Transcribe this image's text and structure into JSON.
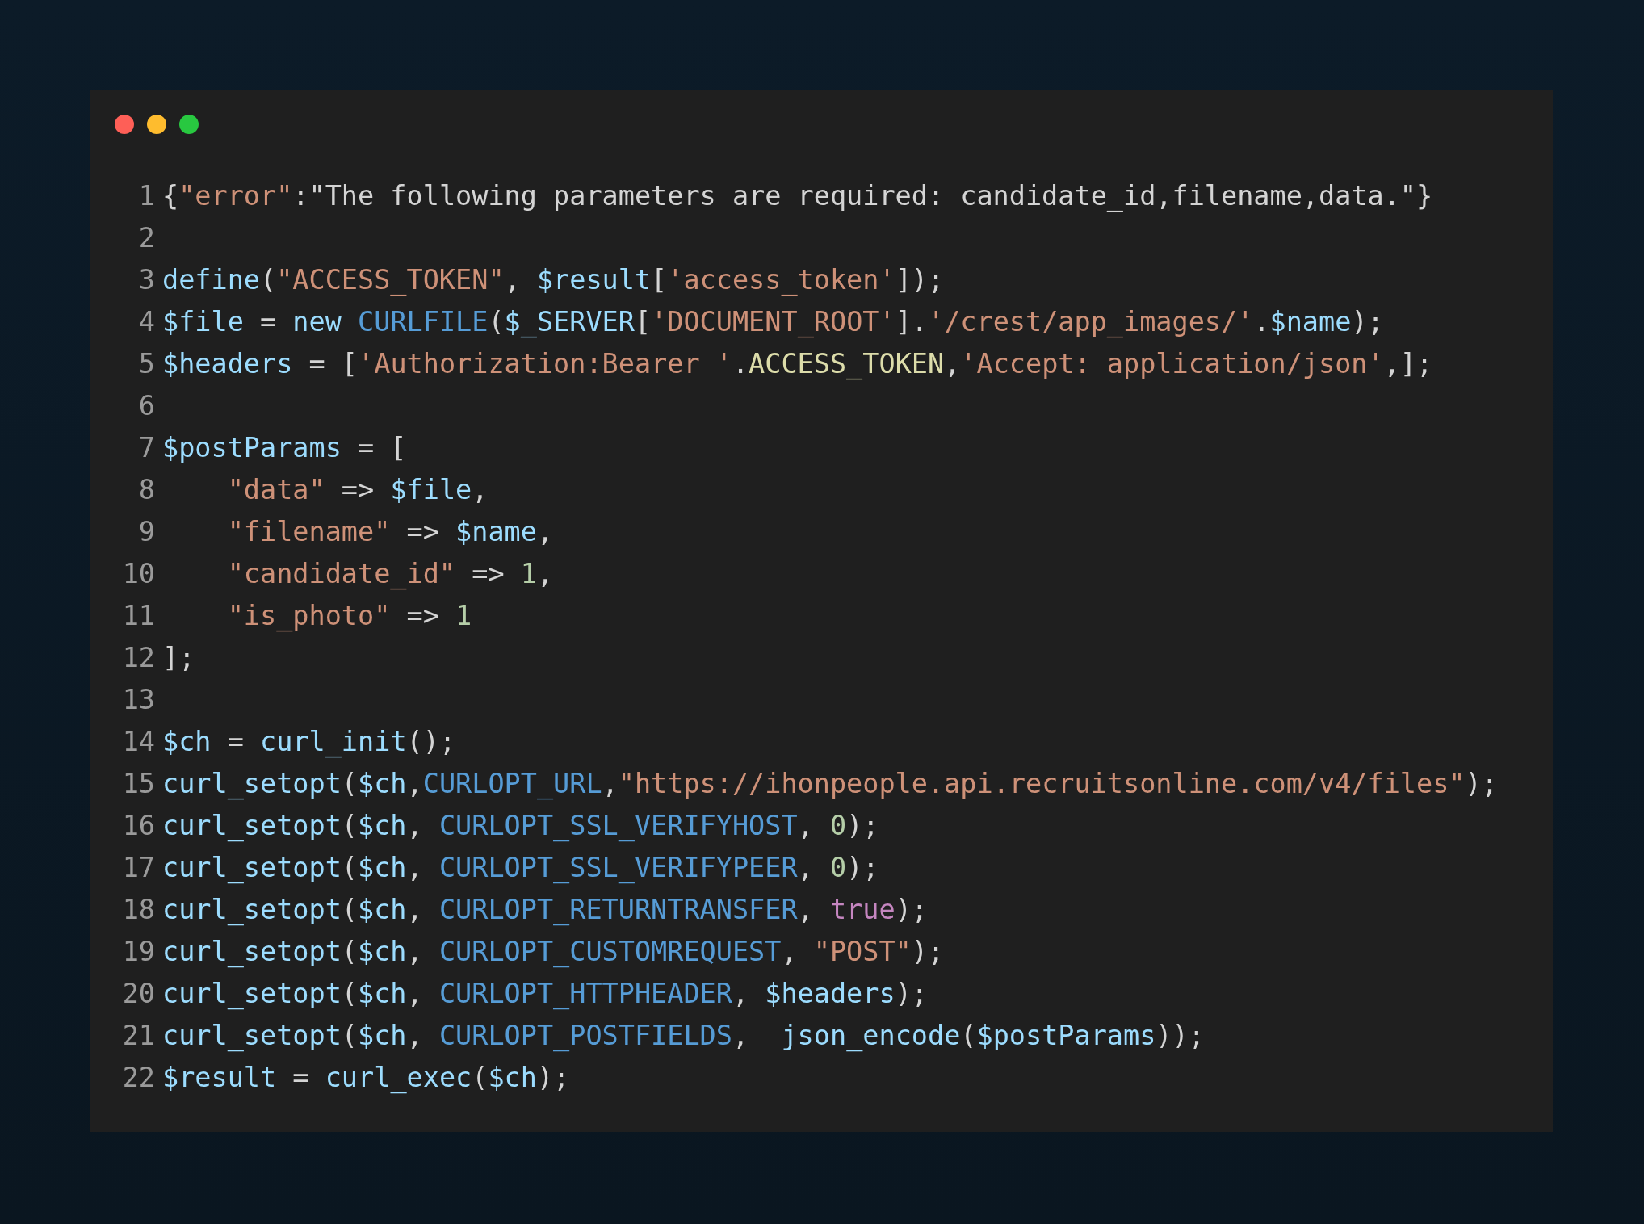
{
  "lines": [
    {
      "number": "1",
      "tokens": [
        {
          "kind": "plain",
          "text": "{"
        },
        {
          "kind": "string",
          "text": "\"error\""
        },
        {
          "kind": "plain",
          "text": ":\"The following parameters are required: candidate_id,filename,data.\"}"
        }
      ]
    },
    {
      "number": "2"
    },
    {
      "number": "3",
      "tokens": [
        {
          "kind": "func",
          "text": "define"
        },
        {
          "kind": "plain",
          "text": "("
        },
        {
          "kind": "string",
          "text": "\"ACCESS_TOKEN\""
        },
        {
          "kind": "plain",
          "text": ", "
        },
        {
          "kind": "var",
          "text": "$result"
        },
        {
          "kind": "plain",
          "text": "["
        },
        {
          "kind": "string",
          "text": "'access_token'"
        },
        {
          "kind": "plain",
          "text": "]);"
        }
      ]
    },
    {
      "number": "4",
      "tokens": [
        {
          "kind": "var",
          "text": "$file"
        },
        {
          "kind": "plain",
          "text": " = "
        },
        {
          "kind": "func",
          "text": "new "
        },
        {
          "kind": "const",
          "text": "CURLFILE"
        },
        {
          "kind": "plain",
          "text": "("
        },
        {
          "kind": "var",
          "text": "$_SERVER"
        },
        {
          "kind": "plain",
          "text": "["
        },
        {
          "kind": "string",
          "text": "'DOCUMENT_ROOT'"
        },
        {
          "kind": "plain",
          "text": "]."
        },
        {
          "kind": "string",
          "text": "'/crest/app_images/'"
        },
        {
          "kind": "plain",
          "text": "."
        },
        {
          "kind": "var",
          "text": "$name"
        },
        {
          "kind": "plain",
          "text": ");"
        }
      ]
    },
    {
      "number": "5",
      "tokens": [
        {
          "kind": "var",
          "text": "$headers"
        },
        {
          "kind": "plain",
          "text": " = ["
        },
        {
          "kind": "string",
          "text": "'Authorization:Bearer '"
        },
        {
          "kind": "plain",
          "text": "."
        },
        {
          "kind": "defined",
          "text": "ACCESS_TOKEN"
        },
        {
          "kind": "plain",
          "text": ","
        },
        {
          "kind": "string",
          "text": "'Accept: application/json'"
        },
        {
          "kind": "plain",
          "text": ",];"
        }
      ]
    },
    {
      "number": "6"
    },
    {
      "number": "7",
      "tokens": [
        {
          "kind": "var",
          "text": "$postParams"
        },
        {
          "kind": "plain",
          "text": " = ["
        }
      ],
      "children": [
        {
          "number": "8",
          "tokens": [
            {
              "kind": "string",
              "text": "\"data\""
            },
            {
              "kind": "plain",
              "text": " => "
            },
            {
              "kind": "var",
              "text": "$file"
            },
            {
              "kind": "plain",
              "text": ","
            }
          ]
        },
        {
          "number": "9",
          "tokens": [
            {
              "kind": "string",
              "text": "\"filename\""
            },
            {
              "kind": "plain",
              "text": " => "
            },
            {
              "kind": "var",
              "text": "$name"
            },
            {
              "kind": "plain",
              "text": ","
            }
          ]
        },
        {
          "number": "10",
          "tokens": [
            {
              "kind": "string",
              "text": "\"candidate_id\""
            },
            {
              "kind": "plain",
              "text": " => "
            },
            {
              "kind": "number",
              "text": "1"
            },
            {
              "kind": "plain",
              "text": ","
            }
          ]
        },
        {
          "number": "11",
          "tokens": [
            {
              "kind": "string",
              "text": "\"is_photo\""
            },
            {
              "kind": "plain",
              "text": " => "
            },
            {
              "kind": "number",
              "text": "1"
            }
          ]
        }
      ]
    },
    {
      "number": "12",
      "tokens": [
        {
          "kind": "plain",
          "text": "];"
        }
      ]
    },
    {
      "number": "13"
    },
    {
      "number": "14",
      "tokens": [
        {
          "kind": "var",
          "text": "$ch"
        },
        {
          "kind": "plain",
          "text": " = "
        },
        {
          "kind": "func",
          "text": "curl_init"
        },
        {
          "kind": "plain",
          "text": "();"
        }
      ]
    },
    {
      "number": "15",
      "tokens": [
        {
          "kind": "func",
          "text": "curl_setopt"
        },
        {
          "kind": "plain",
          "text": "("
        },
        {
          "kind": "var",
          "text": "$ch"
        },
        {
          "kind": "plain",
          "text": ","
        },
        {
          "kind": "const",
          "text": "CURLOPT_URL"
        },
        {
          "kind": "plain",
          "text": ","
        },
        {
          "kind": "string",
          "text": "\"https://ihonpeople.api.recruitsonline.com/v4/files\""
        },
        {
          "kind": "plain",
          "text": ");"
        }
      ]
    },
    {
      "number": "16",
      "tokens": [
        {
          "kind": "func",
          "text": "curl_setopt"
        },
        {
          "kind": "plain",
          "text": "("
        },
        {
          "kind": "var",
          "text": "$ch"
        },
        {
          "kind": "plain",
          "text": ", "
        },
        {
          "kind": "const",
          "text": "CURLOPT_SSL_VERIFYHOST"
        },
        {
          "kind": "plain",
          "text": ", "
        },
        {
          "kind": "number",
          "text": "0"
        },
        {
          "kind": "plain",
          "text": ");"
        }
      ]
    },
    {
      "number": "17",
      "tokens": [
        {
          "kind": "func",
          "text": "curl_setopt"
        },
        {
          "kind": "plain",
          "text": "("
        },
        {
          "kind": "var",
          "text": "$ch"
        },
        {
          "kind": "plain",
          "text": ", "
        },
        {
          "kind": "const",
          "text": "CURLOPT_SSL_VERIFYPEER"
        },
        {
          "kind": "plain",
          "text": ", "
        },
        {
          "kind": "number",
          "text": "0"
        },
        {
          "kind": "plain",
          "text": ");"
        }
      ]
    },
    {
      "number": "18",
      "tokens": [
        {
          "kind": "func",
          "text": "curl_setopt"
        },
        {
          "kind": "plain",
          "text": "("
        },
        {
          "kind": "var",
          "text": "$ch"
        },
        {
          "kind": "plain",
          "text": ", "
        },
        {
          "kind": "const",
          "text": "CURLOPT_RETURNTRANSFER"
        },
        {
          "kind": "plain",
          "text": ", "
        },
        {
          "kind": "keyword",
          "text": "true"
        },
        {
          "kind": "plain",
          "text": ");"
        }
      ]
    },
    {
      "number": "19",
      "tokens": [
        {
          "kind": "func",
          "text": "curl_setopt"
        },
        {
          "kind": "plain",
          "text": "("
        },
        {
          "kind": "var",
          "text": "$ch"
        },
        {
          "kind": "plain",
          "text": ", "
        },
        {
          "kind": "const",
          "text": "CURLOPT_CUSTOMREQUEST"
        },
        {
          "kind": "plain",
          "text": ", "
        },
        {
          "kind": "string",
          "text": "\"POST\""
        },
        {
          "kind": "plain",
          "text": ");"
        }
      ]
    },
    {
      "number": "20",
      "tokens": [
        {
          "kind": "func",
          "text": "curl_setopt"
        },
        {
          "kind": "plain",
          "text": "("
        },
        {
          "kind": "var",
          "text": "$ch"
        },
        {
          "kind": "plain",
          "text": ", "
        },
        {
          "kind": "const",
          "text": "CURLOPT_HTTPHEADER"
        },
        {
          "kind": "plain",
          "text": ", "
        },
        {
          "kind": "var",
          "text": "$headers"
        },
        {
          "kind": "plain",
          "text": ");"
        }
      ]
    },
    {
      "number": "21",
      "tokens": [
        {
          "kind": "func",
          "text": "curl_setopt"
        },
        {
          "kind": "plain",
          "text": "("
        },
        {
          "kind": "var",
          "text": "$ch"
        },
        {
          "kind": "plain",
          "text": ", "
        },
        {
          "kind": "const",
          "text": "CURLOPT_POSTFIELDS"
        },
        {
          "kind": "plain",
          "text": ",  "
        },
        {
          "kind": "func",
          "text": "json_encode"
        },
        {
          "kind": "plain",
          "text": "("
        },
        {
          "kind": "var",
          "text": "$postParams"
        },
        {
          "kind": "plain",
          "text": "));"
        }
      ]
    },
    {
      "number": "22",
      "tokens": [
        {
          "kind": "var",
          "text": "$result"
        },
        {
          "kind": "plain",
          "text": " = "
        },
        {
          "kind": "func",
          "text": "curl_exec"
        },
        {
          "kind": "plain",
          "text": "("
        },
        {
          "kind": "var",
          "text": "$ch"
        },
        {
          "kind": "plain",
          "text": ");"
        }
      ]
    }
  ]
}
